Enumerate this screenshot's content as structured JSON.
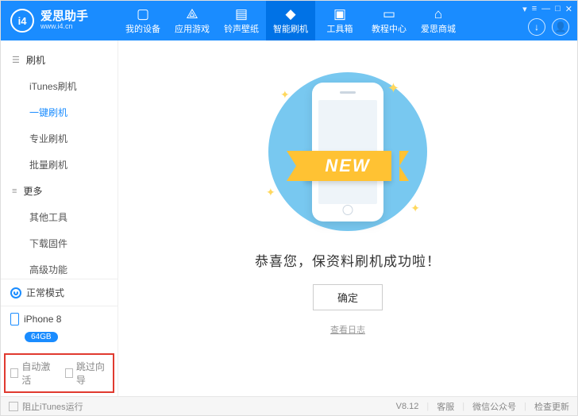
{
  "brand": {
    "logo_text": "i4",
    "name": "爱思助手",
    "url": "www.i4.cn"
  },
  "topnav": {
    "items": [
      {
        "label": "我的设备",
        "icon": "▢"
      },
      {
        "label": "应用游戏",
        "icon": "⟁"
      },
      {
        "label": "铃声壁纸",
        "icon": "▤"
      },
      {
        "label": "智能刷机",
        "icon": "◆",
        "active": true
      },
      {
        "label": "工具箱",
        "icon": "▣"
      },
      {
        "label": "教程中心",
        "icon": "▭"
      },
      {
        "label": "爱思商城",
        "icon": "⌂"
      }
    ]
  },
  "header_icons": {
    "download": "↓",
    "user": "👤"
  },
  "window_controls": [
    "▾",
    "≡",
    "—",
    "□",
    "✕"
  ],
  "sidebar": {
    "sections": [
      {
        "title": "刷机",
        "items": [
          {
            "label": "iTunes刷机"
          },
          {
            "label": "一键刷机",
            "active": true
          },
          {
            "label": "专业刷机"
          },
          {
            "label": "批量刷机"
          }
        ]
      },
      {
        "title": "更多",
        "items": [
          {
            "label": "其他工具"
          },
          {
            "label": "下载固件"
          },
          {
            "label": "高级功能"
          }
        ]
      }
    ],
    "status": "正常模式",
    "device": {
      "name": "iPhone 8",
      "storage": "64GB"
    },
    "options": {
      "auto_activate": "自动激活",
      "skip_guide": "跳过向导"
    }
  },
  "main": {
    "ribbon": "NEW",
    "message": "恭喜您，保资料刷机成功啦！",
    "confirm": "确定",
    "view_log": "查看日志"
  },
  "statusbar": {
    "block_itunes": "阻止iTunes运行",
    "version": "V8.12",
    "support": "客服",
    "wechat": "微信公众号",
    "check_update": "检查更新"
  }
}
